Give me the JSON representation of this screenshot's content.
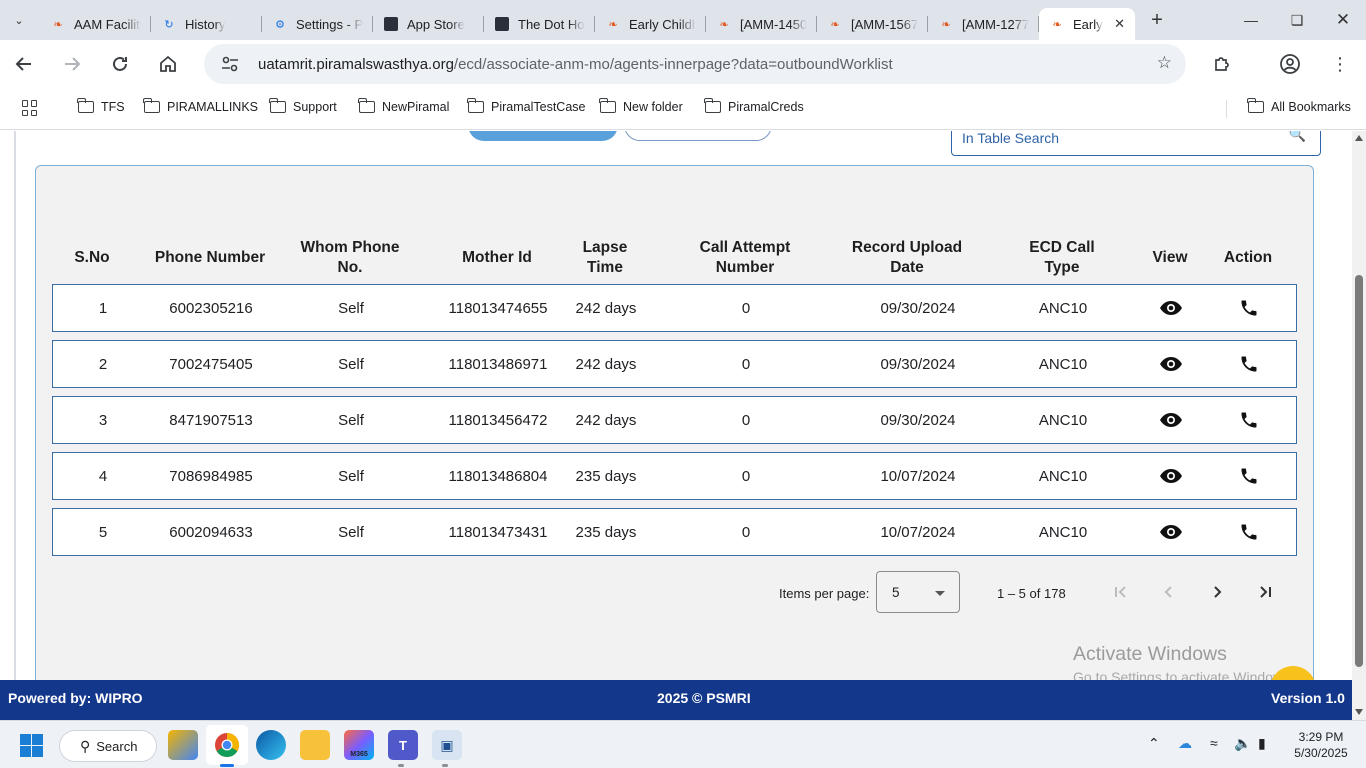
{
  "browser": {
    "tabs": [
      {
        "title": "AAM Facility",
        "favicon": "leaf-icon"
      },
      {
        "title": "History",
        "favicon": "history-icon"
      },
      {
        "title": "Settings - P",
        "favicon": "gear-icon"
      },
      {
        "title": "App Store",
        "favicon": "app-icon"
      },
      {
        "title": "The Dot Hor",
        "favicon": "app-icon"
      },
      {
        "title": "Early Childh",
        "favicon": "leaf-icon"
      },
      {
        "title": "[AMM-1450",
        "favicon": "leaf-icon"
      },
      {
        "title": "[AMM-1567",
        "favicon": "leaf-icon"
      },
      {
        "title": "[AMM-1277",
        "favicon": "leaf-icon"
      },
      {
        "title": "Early",
        "favicon": "leaf-icon"
      }
    ],
    "url_host": "uatamrit.piramalswasthya.org",
    "url_path": "/ecd/associate-anm-mo/agents-innerpage?data=outboundWorklist",
    "bookmarks": [
      "TFS",
      "PIRAMALLINKS",
      "Support",
      "NewPiramal",
      "PiramalTestCase",
      "New folder",
      "PiramalCreds"
    ],
    "all_bookmarks": "All Bookmarks"
  },
  "search": {
    "placeholder": "In Table Search"
  },
  "table": {
    "headers": {
      "sno": "S.No",
      "phone": "Phone Number",
      "whom": "Whom Phone No.",
      "mother": "Mother Id",
      "lapse": "Lapse Time",
      "attempt": "Call Attempt Number",
      "upload": "Record Upload Date",
      "calltype": "ECD Call Type",
      "view": "View",
      "action": "Action"
    },
    "rows": [
      {
        "sno": "1",
        "phone": "6002305216",
        "whom": "Self",
        "mother": "118013474655",
        "lapse": "242 days",
        "attempt": "0",
        "upload": "09/30/2024",
        "calltype": "ANC10"
      },
      {
        "sno": "2",
        "phone": "7002475405",
        "whom": "Self",
        "mother": "118013486971",
        "lapse": "242 days",
        "attempt": "0",
        "upload": "09/30/2024",
        "calltype": "ANC10"
      },
      {
        "sno": "3",
        "phone": "8471907513",
        "whom": "Self",
        "mother": "118013456472",
        "lapse": "242 days",
        "attempt": "0",
        "upload": "09/30/2024",
        "calltype": "ANC10"
      },
      {
        "sno": "4",
        "phone": "7086984985",
        "whom": "Self",
        "mother": "118013486804",
        "lapse": "235 days",
        "attempt": "0",
        "upload": "10/07/2024",
        "calltype": "ANC10"
      },
      {
        "sno": "5",
        "phone": "6002094633",
        "whom": "Self",
        "mother": "118013473431",
        "lapse": "235 days",
        "attempt": "0",
        "upload": "10/07/2024",
        "calltype": "ANC10"
      }
    ],
    "view_icon": "eye-icon",
    "action_icon": "phone-icon"
  },
  "paginator": {
    "items_per_page_label": "Items per page:",
    "items_per_page_value": "5",
    "range_label": "1 – 5 of 178"
  },
  "watermark": {
    "title": "Activate Windows",
    "subtitle": "Go to Settings to activate Windows."
  },
  "footer": {
    "left": "Powered by: WIPRO",
    "center": "2025 © PSMRI",
    "right": "Version 1.0"
  },
  "taskbar": {
    "search_label": "Search",
    "m365_label": "M365",
    "time": "3:29 PM",
    "date": "5/30/2025"
  },
  "colors": {
    "footer_bg": "#13378a",
    "row_border": "#3a6ea8",
    "primary_btn": "#5aa1dc"
  }
}
